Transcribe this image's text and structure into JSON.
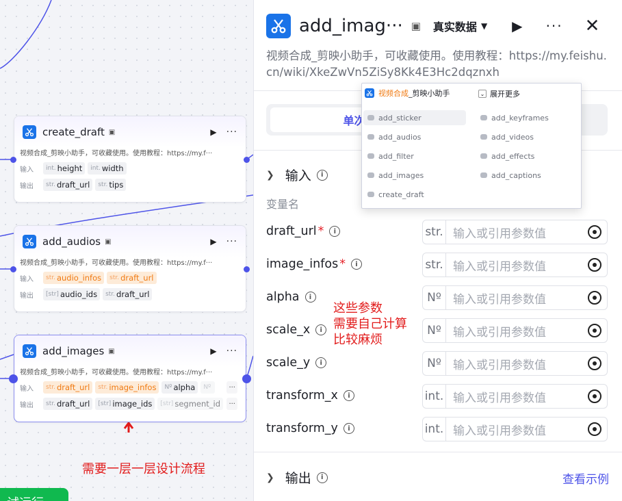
{
  "canvas": {
    "nodes": [
      {
        "title": "create_draft",
        "description": "视频合成_剪映小助手，可收藏使用。使用教程：https://my.f···",
        "input_label": "输入",
        "output_label": "输出",
        "inputs": [
          {
            "type": "int.",
            "name": "height"
          },
          {
            "type": "int.",
            "name": "width"
          }
        ],
        "outputs": [
          {
            "type": "str.",
            "name": "draft_url"
          },
          {
            "type": "str.",
            "name": "tips"
          }
        ]
      },
      {
        "title": "add_audios",
        "description": "视频合成_剪映小助手，可收藏使用。使用教程：https://my.f···",
        "input_label": "输入",
        "output_label": "输出",
        "inputs": [
          {
            "type": "str.",
            "name": "audio_infos"
          },
          {
            "type": "str.",
            "name": "draft_url"
          }
        ],
        "outputs": [
          {
            "type": "[str]",
            "name": "audio_ids"
          },
          {
            "type": "str.",
            "name": "draft_url"
          }
        ]
      },
      {
        "title": "add_images",
        "description": "视频合成_剪映小助手，可收藏使用。使用教程：https://my.f···",
        "input_label": "输入",
        "output_label": "输出",
        "inputs": [
          {
            "type": "str.",
            "name": "draft_url"
          },
          {
            "type": "str.",
            "name": "image_infos"
          },
          {
            "type": "Nº",
            "name": "alpha"
          },
          {
            "type": "Nº",
            "name": ""
          }
        ],
        "outputs": [
          {
            "type": "str.",
            "name": "draft_url"
          },
          {
            "type": "[str]",
            "name": "image_ids"
          },
          {
            "type": "[str]",
            "name": "segment_id"
          }
        ],
        "more": "···"
      }
    ],
    "annotation_bottom": "需要一层一层设计流程",
    "annotation_right": [
      "这些参数",
      "需要自己计算",
      "比较麻烦"
    ],
    "bottom_button": "试运行"
  },
  "panel": {
    "title": "add_imag···",
    "mode": "真实数据",
    "description": "视频合成_剪映小助手，可收藏使用。使用教程：https://my.feishu.cn/wiki/XkeZwVn5ZiSy8Kk4E3Hc2dqznxh",
    "tab_active": "单次",
    "input_section": "输入",
    "var_header": "变量名",
    "params": [
      {
        "name": "draft_url",
        "required": true,
        "type": "str.",
        "placeholder": "输入或引用参数值"
      },
      {
        "name": "image_infos",
        "required": true,
        "type": "str.",
        "placeholder": "输入或引用参数值"
      },
      {
        "name": "alpha",
        "required": false,
        "type": "Nº",
        "placeholder": "输入或引用参数值"
      },
      {
        "name": "scale_x",
        "required": false,
        "type": "Nº",
        "placeholder": "输入或引用参数值"
      },
      {
        "name": "scale_y",
        "required": false,
        "type": "Nº",
        "placeholder": "输入或引用参数值"
      },
      {
        "name": "transform_x",
        "required": false,
        "type": "int.",
        "placeholder": "输入或引用参数值"
      },
      {
        "name": "transform_y",
        "required": false,
        "type": "int.",
        "placeholder": "输入或引用参数值"
      }
    ],
    "output_section": "输出",
    "example_link": "查看示例"
  },
  "popup": {
    "brand": "视频合成",
    "brand_suffix": "_剪映小助手",
    "expand": "展开更多",
    "tools_left": [
      "add_sticker",
      "add_audios",
      "add_filter",
      "add_images",
      "create_draft"
    ],
    "tools_right": [
      "add_keyframes",
      "add_videos",
      "add_effects",
      "add_captions"
    ]
  },
  "colors": {
    "accent": "#4d53e8",
    "brand_icon": "#1a73e8",
    "annotation": "#e21c1c",
    "orange_tag": "#f07a12"
  }
}
